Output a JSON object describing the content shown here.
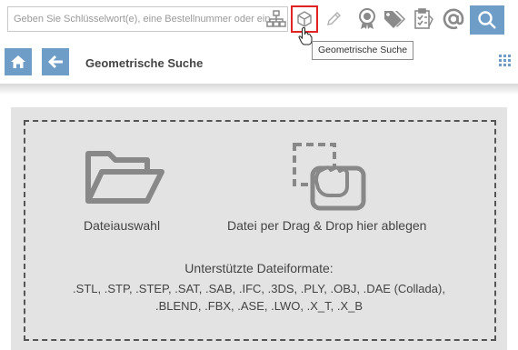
{
  "search": {
    "placeholder": "Geben Sie Schlüsselwort(e), eine Bestellnummer oder ein"
  },
  "toolbar": {
    "icons": [
      "hierarchy-icon",
      "cube-icon",
      "pencil-icon",
      "award-icon",
      "tags-icon",
      "clipboard-icon",
      "at-icon",
      "search-icon"
    ],
    "tooltip": "Geometrische Suche"
  },
  "header": {
    "title": "Geometrische Suche"
  },
  "dropzone": {
    "file_select_label": "Dateiauswahl",
    "drag_drop_label": "Datei per Drag & Drop hier ablegen",
    "formats_title": "Unterstützte Dateiformate:",
    "formats_line1": ".STL, .STP, .STEP, .SAT, .SAB, .IFC, .3DS, .PLY, .OBJ, .DAE (Collada),",
    "formats_line2": ".BLEND, .FBX, .ASE, .LWO, .X_T, .X_B"
  },
  "colors": {
    "accent": "#6e9dc7",
    "highlight": "#e02424",
    "panel": "#e3e3e3"
  }
}
